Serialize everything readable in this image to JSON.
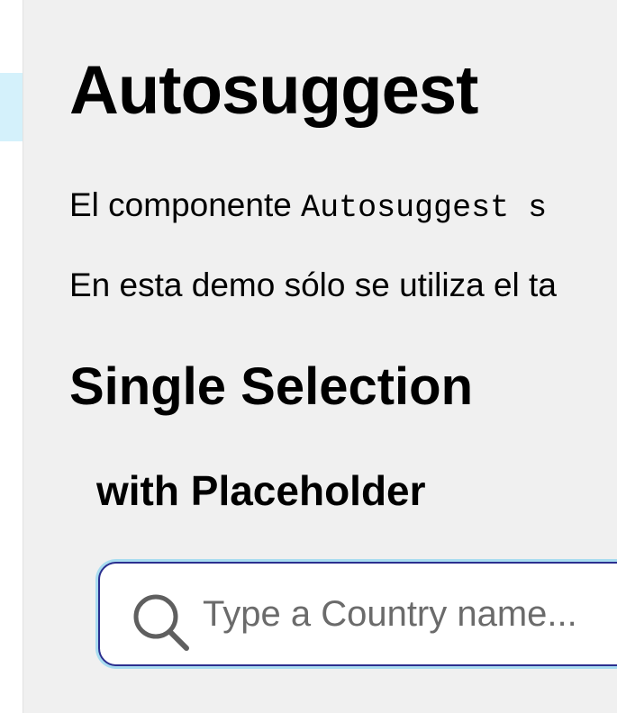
{
  "sidebar": {
    "active_item_color": "#d4f1fb"
  },
  "page": {
    "title": "Autosuggest",
    "intro": {
      "prefix": "El componente ",
      "code": "Autosuggest",
      "suffix": " s"
    },
    "demo_note": "En esta demo sólo se utiliza el ta"
  },
  "section": {
    "title": "Single Selection",
    "subsection_title": "with Placeholder"
  },
  "search": {
    "placeholder": "Type a Country name...",
    "value": "",
    "icon": "search-icon",
    "border_color": "#2b2f8f",
    "focus_ring_color": "#a8dcf0"
  }
}
